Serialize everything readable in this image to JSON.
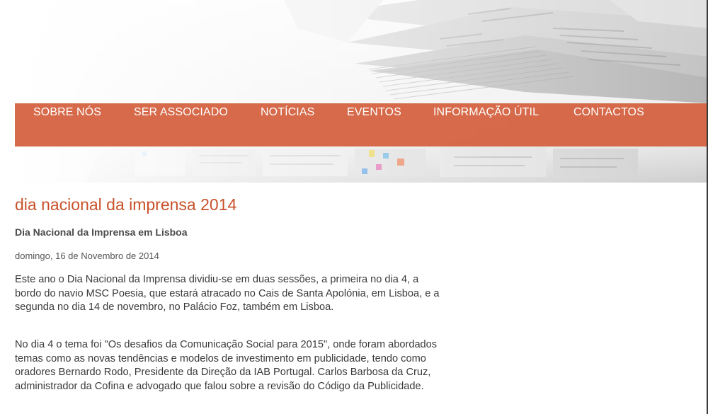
{
  "nav": {
    "items": [
      {
        "label": "SOBRE NÓS"
      },
      {
        "label": "SER ASSOCIADO"
      },
      {
        "label": "NOTÍCIAS"
      },
      {
        "label": "EVENTOS"
      },
      {
        "label": "INFORMAÇÃO ÚTIL"
      },
      {
        "label": "CONTACTOS"
      }
    ]
  },
  "banner": {
    "image": "newspapers-stack-image"
  },
  "page": {
    "title": "dia nacional da imprensa 2014"
  },
  "article": {
    "heading": "Dia Nacional da Imprensa em Lisboa",
    "date": "domingo, 16 de Novembro de 2014",
    "paragraphs": [
      "Este ano o Dia Nacional da Imprensa dividiu-se em duas sessões, a primeira no dia 4, a bordo do navio MSC Poesia, que estará atracado no Cais de Santa Apolónia, em Lisboa, e a segunda no dia 14 de novembro, no Palácio Foz, também em Lisboa.",
      "No dia 4 o tema foi \"Os desafios da Comunicação Social para 2015\", onde foram abordados temas como as novas tendências e modelos de investimento em publicidade, tendo como oradores Bernardo Rodo, Presidente da Direção da IAB Portugal. Carlos Barbosa da Cruz, administrador da Cofina e advogado que falou sobre a revisão do Código da Publicidade."
    ]
  },
  "colors": {
    "accent": "#d35f3c",
    "title": "#c8522a",
    "text": "#3a3a3a"
  }
}
